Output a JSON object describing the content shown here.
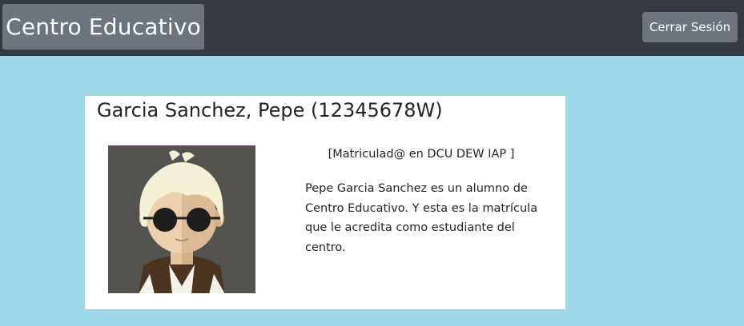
{
  "navbar": {
    "brand": "Centro Educativo",
    "logout_label": "Cerrar Sesión"
  },
  "student": {
    "name": "Garcia Sanchez, Pepe (12345678W)",
    "enrollment": "[Matriculad@ en DCU DEW IAP ]",
    "description": "Pepe Garcia Sanchez es un alumno de Centro Educativo. Y esta es la matrícula que le acredita como estudiante del centro.",
    "photo_icon": "student-avatar-icon"
  },
  "colors": {
    "background": "#9dd9e8",
    "navbar": "#343a40",
    "button": "#6c757d",
    "card": "#ffffff"
  }
}
